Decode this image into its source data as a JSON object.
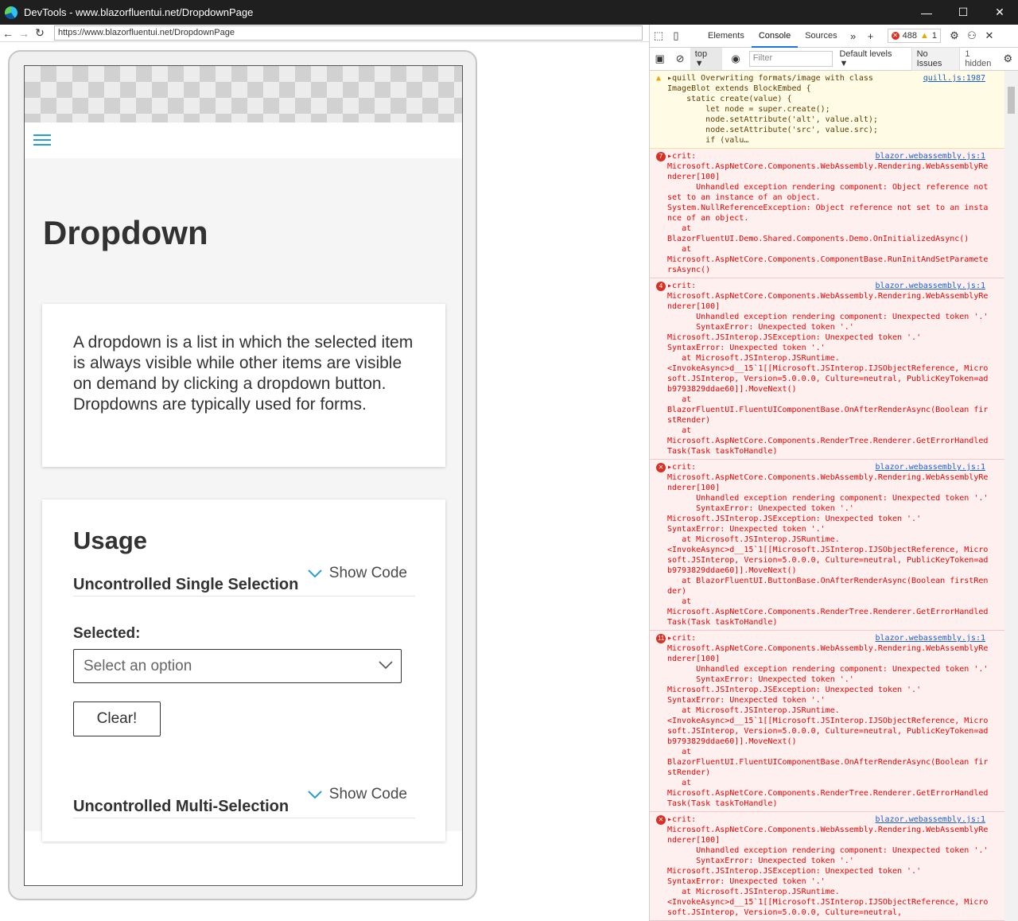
{
  "window": {
    "title": "DevTools - www.blazorfluentui.net/DropdownPage",
    "min": "—",
    "max": "☐",
    "close": "✕"
  },
  "address": {
    "url": "https://www.blazorfluentui.net/DropdownPage"
  },
  "page": {
    "title": "Dropdown",
    "description": "A dropdown is a list in which the selected item is always visible while other items are visible on demand by clicking a dropdown button. Dropdowns are typically used for forms.",
    "usage_title": "Usage",
    "sections": [
      {
        "label": "Uncontrolled Single Selection",
        "show_code": "Show Code"
      },
      {
        "label": "Uncontrolled Multi-Selection",
        "show_code": "Show Code"
      }
    ],
    "selected_label": "Selected:",
    "dropdown_placeholder": "Select an option",
    "clear_button": "Clear!"
  },
  "devtools": {
    "tabs": [
      "Elements",
      "Console",
      "Sources"
    ],
    "active_tab": "Console",
    "error_count": "488",
    "warning_count": "1",
    "context": "top ▼",
    "filter_placeholder": "Filter",
    "levels": "Default levels ▼",
    "issues": "No Issues",
    "hidden": "1 hidden",
    "entries": [
      {
        "type": "warn",
        "badge": "",
        "source": "quill.js:1987",
        "text": "▸quill Overwriting formats/image with class\nImageBlot extends BlockEmbed {\n    static create(value) {\n        let node = super.create();\n        node.setAttribute('alt', value.alt);\n        node.setAttribute('src', value.src);\n        if (valu…"
      },
      {
        "type": "error",
        "badge": "7",
        "source": "blazor.webassembly.js:1",
        "text": "▸crit:\nMicrosoft.AspNetCore.Components.WebAssembly.Rendering.WebAssemblyRenderer[100]\n      Unhandled exception rendering component: Object reference not set to an instance of an object.\nSystem.NullReferenceException: Object reference not set to an instance of an object.\n   at\nBlazorFluentUI.Demo.Shared.Components.Demo.OnInitializedAsync()\n   at\nMicrosoft.AspNetCore.Components.ComponentBase.RunInitAndSetParametersAsync()"
      },
      {
        "type": "error",
        "badge": "4",
        "source": "blazor.webassembly.js:1",
        "text": "▸crit:\nMicrosoft.AspNetCore.Components.WebAssembly.Rendering.WebAssemblyRenderer[100]\n      Unhandled exception rendering component: Unexpected token '.'\n      SyntaxError: Unexpected token '.'\nMicrosoft.JSInterop.JSException: Unexpected token '.'\nSyntaxError: Unexpected token '.'\n   at Microsoft.JSInterop.JSRuntime.\n<InvokeAsync>d__15`1[[Microsoft.JSInterop.IJSObjectReference, Microsoft.JSInterop, Version=5.0.0.0, Culture=neutral, PublicKeyToken=adb9793829ddae60]].MoveNext()\n   at\nBlazorFluentUI.FluentUIComponentBase.OnAfterRenderAsync(Boolean firstRender)\n   at\nMicrosoft.AspNetCore.Components.RenderTree.Renderer.GetErrorHandledTask(Task taskToHandle)"
      },
      {
        "type": "error",
        "badge": "",
        "source": "blazor.webassembly.js:1",
        "text": "▸crit:\nMicrosoft.AspNetCore.Components.WebAssembly.Rendering.WebAssemblyRenderer[100]\n      Unhandled exception rendering component: Unexpected token '.'\n      SyntaxError: Unexpected token '.'\nMicrosoft.JSInterop.JSException: Unexpected token '.'\nSyntaxError: Unexpected token '.'\n   at Microsoft.JSInterop.JSRuntime.\n<InvokeAsync>d__15`1[[Microsoft.JSInterop.IJSObjectReference, Microsoft.JSInterop, Version=5.0.0.0, Culture=neutral, PublicKeyToken=adb9793829ddae60]].MoveNext()\n   at BlazorFluentUI.ButtonBase.OnAfterRenderAsync(Boolean firstRender)\n   at\nMicrosoft.AspNetCore.Components.RenderTree.Renderer.GetErrorHandledTask(Task taskToHandle)"
      },
      {
        "type": "error",
        "badge": "11",
        "source": "blazor.webassembly.js:1",
        "text": "▸crit:\nMicrosoft.AspNetCore.Components.WebAssembly.Rendering.WebAssemblyRenderer[100]\n      Unhandled exception rendering component: Unexpected token '.'\n      SyntaxError: Unexpected token '.'\nMicrosoft.JSInterop.JSException: Unexpected token '.'\nSyntaxError: Unexpected token '.'\n   at Microsoft.JSInterop.JSRuntime.\n<InvokeAsync>d__15`1[[Microsoft.JSInterop.IJSObjectReference, Microsoft.JSInterop, Version=5.0.0.0, Culture=neutral, PublicKeyToken=adb9793829ddae60]].MoveNext()\n   at\nBlazorFluentUI.FluentUIComponentBase.OnAfterRenderAsync(Boolean firstRender)\n   at\nMicrosoft.AspNetCore.Components.RenderTree.Renderer.GetErrorHandledTask(Task taskToHandle)"
      },
      {
        "type": "error",
        "badge": "",
        "source": "blazor.webassembly.js:1",
        "text": "▸crit:\nMicrosoft.AspNetCore.Components.WebAssembly.Rendering.WebAssemblyRenderer[100]\n      Unhandled exception rendering component: Unexpected token '.'\n      SyntaxError: Unexpected token '.'\nMicrosoft.JSInterop.JSException: Unexpected token '.'\nSyntaxError: Unexpected token '.'\n   at Microsoft.JSInterop.JSRuntime.\n<InvokeAsync>d__15`1[[Microsoft.JSInterop.IJSObjectReference, Microsoft.JSInterop, Version=5.0.0.0, Culture=neutral,"
      }
    ]
  }
}
